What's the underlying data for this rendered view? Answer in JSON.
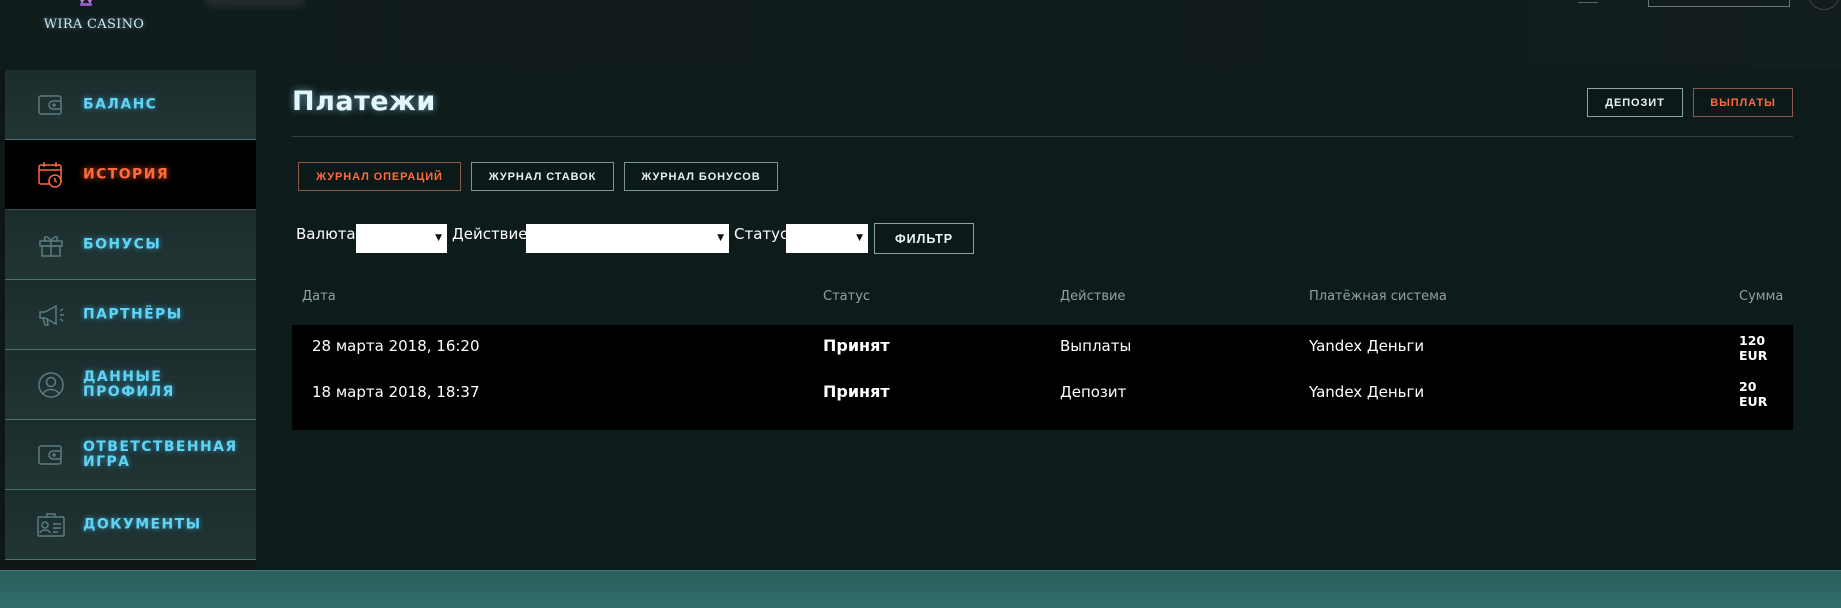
{
  "brand": {
    "logo_text": "WIRA CASINO"
  },
  "sidebar": {
    "items": [
      {
        "label": "БАЛАНС",
        "icon": "wallet-icon",
        "active": false
      },
      {
        "label": "ИСТОРИЯ",
        "icon": "calendar-clock-icon",
        "active": true
      },
      {
        "label": "БОНУСЫ",
        "icon": "gift-icon",
        "active": false
      },
      {
        "label": "ПАРТНЁРЫ",
        "icon": "megaphone-icon",
        "active": false
      },
      {
        "label": "ДАННЫЕ ПРОФИЛЯ",
        "icon": "user-icon",
        "active": false
      },
      {
        "label": "ОТВЕТСТВЕННАЯ ИГРА",
        "icon": "wallet-icon",
        "active": false
      },
      {
        "label": "ДОКУМЕНТЫ",
        "icon": "id-card-icon",
        "active": false
      }
    ]
  },
  "main": {
    "title": "Платежи",
    "actions": {
      "deposit": "ДЕПОЗИТ",
      "withdraw": "ВЫПЛАТЫ"
    },
    "tabs": [
      {
        "label": "ЖУРНАЛ ОПЕРАЦИЙ",
        "active": true
      },
      {
        "label": "ЖУРНАЛ СТАВОК",
        "active": false
      },
      {
        "label": "ЖУРНАЛ БОНУСОВ",
        "active": false
      }
    ],
    "filters": {
      "currency_label": "Валюта",
      "currency_value": "",
      "action_label": "Действие",
      "action_value": "",
      "status_label": "Статус",
      "status_value": "",
      "filter_button": "ФИЛЬТР"
    },
    "table": {
      "headers": {
        "date": "Дата",
        "status": "Статус",
        "action": "Действие",
        "system": "Платёжная система",
        "amount": "Сумма"
      },
      "rows": [
        {
          "date": "28 марта 2018, 16:20",
          "status": "Принят",
          "action": "Выплаты",
          "system": "Yandex Деньги",
          "amount": "120",
          "currency": "EUR"
        },
        {
          "date": "18 марта 2018, 18:37",
          "status": "Принят",
          "action": "Депозит",
          "system": "Yandex Деньги",
          "amount": "20",
          "currency": "EUR"
        }
      ]
    }
  },
  "colors": {
    "accent_active": "#ff6a3c",
    "accent_link": "#61d4f4",
    "background": "#0e1b1b"
  }
}
